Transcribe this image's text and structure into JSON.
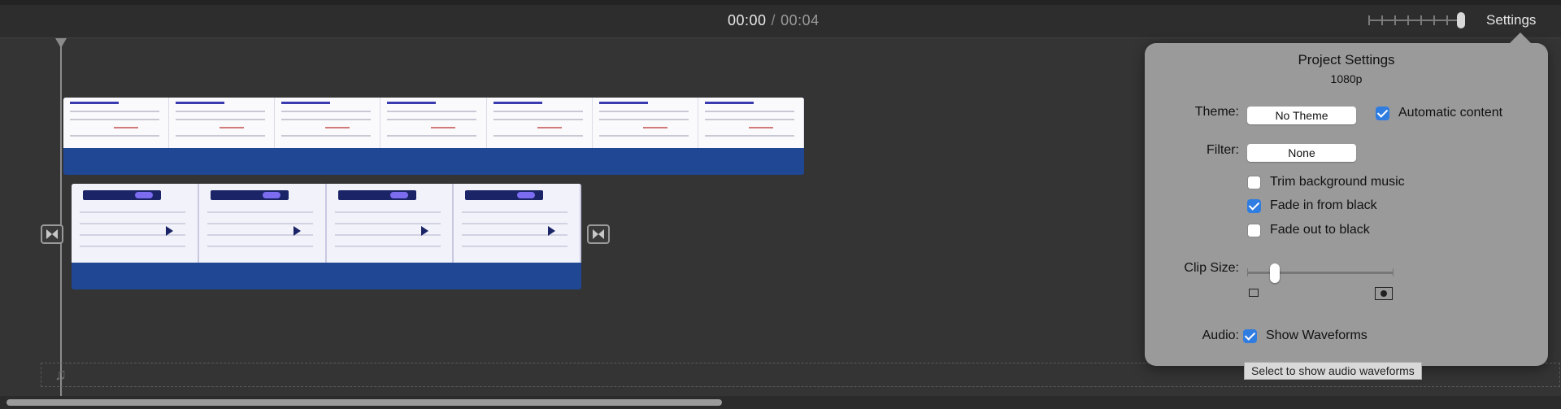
{
  "toolbar": {
    "current_time": "00:00",
    "separator": "/",
    "duration": "00:04",
    "settings_label": "Settings"
  },
  "project_settings": {
    "title": "Project Settings",
    "resolution": "1080p",
    "theme_label": "Theme:",
    "theme_value": "No Theme",
    "automatic_content_label": "Automatic content",
    "automatic_content_checked": true,
    "filter_label": "Filter:",
    "filter_value": "None",
    "trim_music_label": "Trim background music",
    "trim_music_checked": false,
    "fade_in_label": "Fade in from black",
    "fade_in_checked": true,
    "fade_out_label": "Fade out to black",
    "fade_out_checked": false,
    "clip_size_label": "Clip Size:",
    "audio_label": "Audio:",
    "show_waveforms_label": "Show Waveforms",
    "show_waveforms_checked": true
  },
  "tooltip": {
    "text": "Select to show audio waveforms"
  },
  "clip_thumb": {
    "title": "Global API Inventory",
    "tag": "Hubs",
    "tag2": "Inventory"
  },
  "colors": {
    "clip_blue": "#1f4794",
    "checkbox_blue": "#2f7de1",
    "popover_bg": "#9a9a9a"
  },
  "icons": [
    "transition-icon",
    "music-note-icon",
    "small-clip-icon",
    "large-clip-icon",
    "playhead-marker-icon"
  ]
}
